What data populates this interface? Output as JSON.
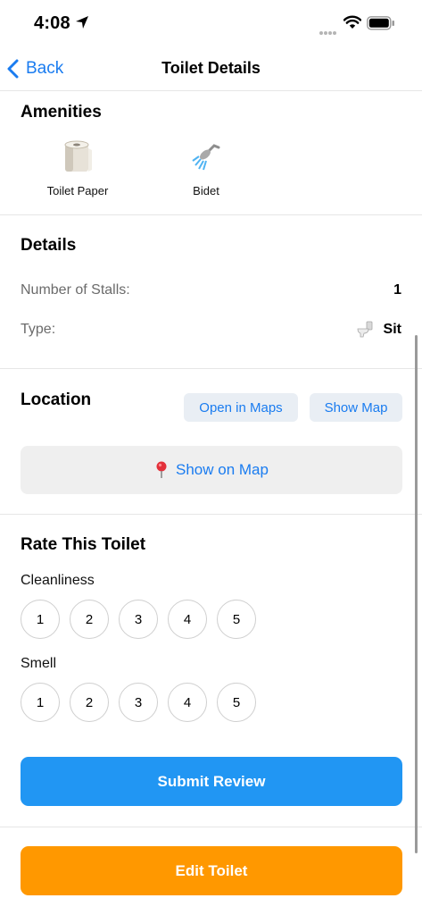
{
  "status_bar": {
    "time": "4:08"
  },
  "nav": {
    "back_label": "Back",
    "title": "Toilet Details"
  },
  "amenities": {
    "title": "Amenities",
    "items": [
      {
        "label": "Toilet Paper",
        "icon": "toilet-paper-icon"
      },
      {
        "label": "Bidet",
        "icon": "shower-head-icon"
      }
    ]
  },
  "details": {
    "title": "Details",
    "stalls_label": "Number of Stalls:",
    "stalls_value": "1",
    "type_label": "Type:",
    "type_value": "Sit",
    "type_icon": "toilet-icon"
  },
  "location": {
    "title": "Location",
    "open_in_maps_label": "Open in Maps",
    "show_map_label": "Show Map",
    "show_on_map_label": "Show on Map",
    "pin_icon": "map-pin-icon"
  },
  "rating": {
    "title": "Rate This Toilet",
    "cleanliness_label": "Cleanliness",
    "smell_label": "Smell",
    "options": [
      "1",
      "2",
      "3",
      "4",
      "5"
    ]
  },
  "actions": {
    "submit_label": "Submit Review",
    "edit_label": "Edit Toilet"
  },
  "colors": {
    "accent": "#1a7cf0",
    "submit": "#2196f3",
    "edit": "#ff9800"
  }
}
